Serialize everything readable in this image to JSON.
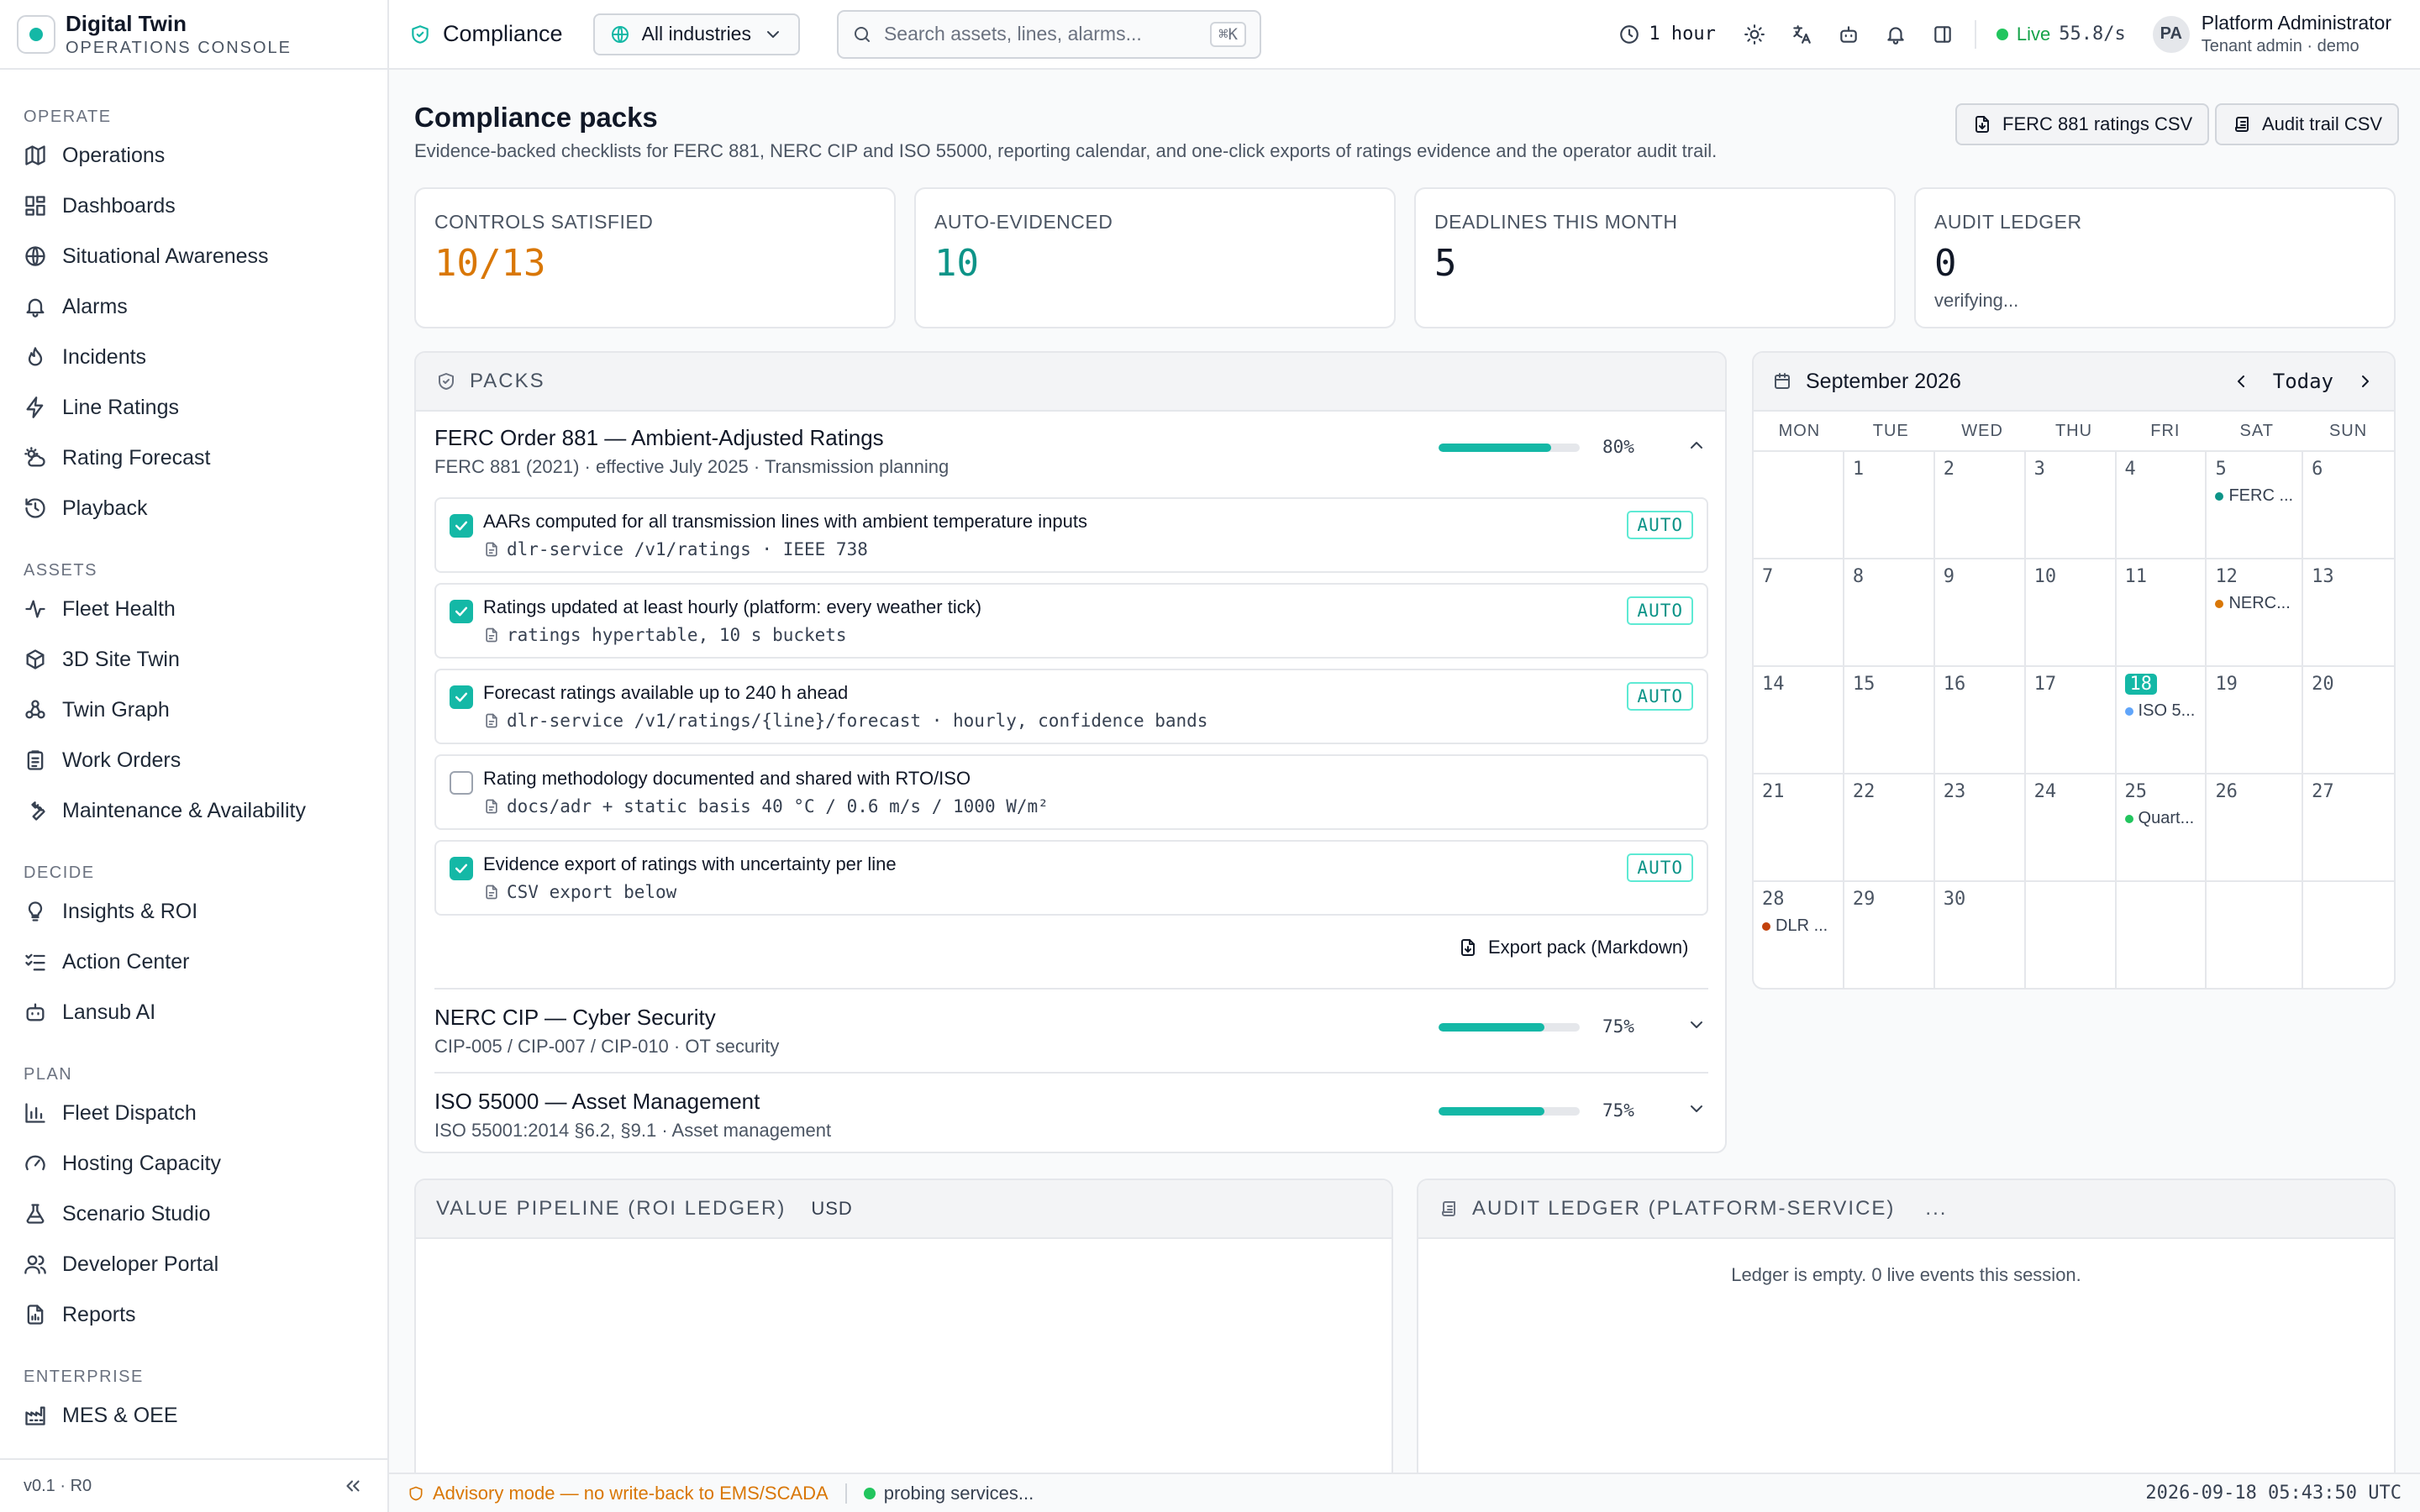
{
  "app": {
    "title": "Digital Twin",
    "subtitle": "OPERATIONS CONSOLE",
    "version": "v0.1 · R0"
  },
  "sidebar": {
    "sections": [
      {
        "label": "OPERATE",
        "items": [
          {
            "label": "Operations",
            "icon": "map-icon"
          },
          {
            "label": "Dashboards",
            "icon": "dashboard-icon"
          },
          {
            "label": "Situational Awareness",
            "icon": "globe-icon"
          },
          {
            "label": "Alarms",
            "icon": "bell-icon"
          },
          {
            "label": "Incidents",
            "icon": "flame-icon"
          },
          {
            "label": "Line Ratings",
            "icon": "bolt-icon"
          },
          {
            "label": "Rating Forecast",
            "icon": "cloud-sun-icon"
          },
          {
            "label": "Playback",
            "icon": "history-icon"
          }
        ]
      },
      {
        "label": "ASSETS",
        "items": [
          {
            "label": "Fleet Health",
            "icon": "pulse-icon"
          },
          {
            "label": "3D Site Twin",
            "icon": "cube-icon"
          },
          {
            "label": "Twin Graph",
            "icon": "graph-icon"
          },
          {
            "label": "Work Orders",
            "icon": "clipboard-icon"
          },
          {
            "label": "Maintenance & Availability",
            "icon": "wrench-icon"
          }
        ]
      },
      {
        "label": "DECIDE",
        "items": [
          {
            "label": "Insights & ROI",
            "icon": "lightbulb-icon"
          },
          {
            "label": "Action Center",
            "icon": "list-check-icon"
          },
          {
            "label": "Lansub AI",
            "icon": "bot-icon"
          }
        ]
      },
      {
        "label": "PLAN",
        "items": [
          {
            "label": "Fleet Dispatch",
            "icon": "bar-chart-icon"
          },
          {
            "label": "Hosting Capacity",
            "icon": "gauge-icon"
          },
          {
            "label": "Scenario Studio",
            "icon": "flask-icon"
          },
          {
            "label": "Developer Portal",
            "icon": "users-icon"
          },
          {
            "label": "Reports",
            "icon": "file-chart-icon"
          }
        ]
      },
      {
        "label": "ENTERPRISE",
        "items": [
          {
            "label": "MES & OEE",
            "icon": "factory-icon"
          }
        ]
      }
    ]
  },
  "topbar": {
    "page": "Compliance",
    "industry": "All industries",
    "search_placeholder": "Search assets, lines, alarms...",
    "search_kbd": "⌘K",
    "time_range": "1 hour",
    "live_label": "Live",
    "live_rate": "55.8/s",
    "user": {
      "initials": "PA",
      "name": "Platform Administrator",
      "role": "Tenant admin · demo"
    }
  },
  "page": {
    "title": "Compliance packs",
    "description": "Evidence-backed checklists for FERC 881, NERC CIP and ISO 55000, reporting calendar, and one-click exports of ratings evidence and the operator audit trail.",
    "buttons": {
      "ferc_csv": "FERC 881 ratings CSV",
      "audit_csv": "Audit trail CSV"
    }
  },
  "kpis": [
    {
      "label": "CONTROLS SATISFIED",
      "value": "10/13",
      "color": "#d97706",
      "sub": ""
    },
    {
      "label": "AUTO-EVIDENCED",
      "value": "10",
      "color": "#0d9488",
      "sub": ""
    },
    {
      "label": "DEADLINES THIS MONTH",
      "value": "5",
      "color": "#111827",
      "sub": ""
    },
    {
      "label": "AUDIT LEDGER",
      "value": "0",
      "color": "#111827",
      "sub": "verifying..."
    }
  ],
  "packs_panel": {
    "title": "PACKS",
    "packs": [
      {
        "title": "FERC Order 881 — Ambient-Adjusted Ratings",
        "meta": "FERC 881 (2021) · effective July 2025 · Transmission planning",
        "progress": 80,
        "pct": "80%",
        "expanded": true,
        "controls": [
          {
            "title": "AARs computed for all transmission lines with ambient temperature inputs",
            "evidence": "dlr-service /v1/ratings · IEEE 738",
            "checked": true,
            "badge": "AUTO"
          },
          {
            "title": "Ratings updated at least hourly (platform: every weather tick)",
            "evidence": "ratings hypertable, 10 s buckets",
            "checked": true,
            "badge": "AUTO"
          },
          {
            "title": "Forecast ratings available up to 240 h ahead",
            "evidence": "dlr-service /v1/ratings/{line}/forecast · hourly, confidence bands",
            "checked": true,
            "badge": "AUTO"
          },
          {
            "title": "Rating methodology documented and shared with RTO/ISO",
            "evidence": "docs/adr + static basis 40 °C / 0.6 m/s / 1000 W/m²",
            "checked": false,
            "badge": ""
          },
          {
            "title": "Evidence export of ratings with uncertainty per line",
            "evidence": "CSV export below",
            "checked": true,
            "badge": "AUTO"
          }
        ],
        "export_label": "Export pack (Markdown)"
      },
      {
        "title": "NERC CIP — Cyber Security",
        "meta": "CIP-005 / CIP-007 / CIP-010 · OT security",
        "progress": 75,
        "pct": "75%",
        "expanded": false
      },
      {
        "title": "ISO 55000 — Asset Management",
        "meta": "ISO 55001:2014 §6.2, §9.1 · Asset management",
        "progress": 75,
        "pct": "75%",
        "expanded": false
      }
    ]
  },
  "calendar": {
    "month": "September 2026",
    "today_label": "Today",
    "dow": [
      "MON",
      "TUE",
      "WED",
      "THU",
      "FRI",
      "SAT",
      "SUN"
    ],
    "days": [
      "",
      "1",
      "2",
      "3",
      "4",
      "5",
      "6",
      "7",
      "8",
      "9",
      "10",
      "11",
      "12",
      "13",
      "14",
      "15",
      "16",
      "17",
      "18",
      "19",
      "20",
      "21",
      "22",
      "23",
      "24",
      "25",
      "26",
      "27",
      "28",
      "29",
      "30",
      "",
      "",
      "",
      ""
    ],
    "today": "18",
    "events": {
      "5": {
        "label": "FERC ...",
        "color": "#0d9488"
      },
      "12": {
        "label": "NERC...",
        "color": "#d97706"
      },
      "18": {
        "label": "ISO 5...",
        "color": "#60a5fa"
      },
      "25": {
        "label": "Quart...",
        "color": "#22c55e"
      },
      "28": {
        "label": "DLR ...",
        "color": "#c2410c"
      }
    }
  },
  "value_pipeline": {
    "title": "VALUE PIPELINE (ROI LEDGER)",
    "currency": "USD"
  },
  "audit_ledger": {
    "title": "AUDIT LEDGER (PLATFORM-SERVICE)",
    "more": "...",
    "empty": "Ledger is empty. 0 live events this session."
  },
  "footer": {
    "advisory": "Advisory mode — no write-back to EMS/SCADA",
    "status": "probing services...",
    "timestamp": "2026-09-18 05:43:50 UTC"
  },
  "colors": {
    "accent": "#14b8a6",
    "warning": "#d97706",
    "live": "#22c55e"
  }
}
